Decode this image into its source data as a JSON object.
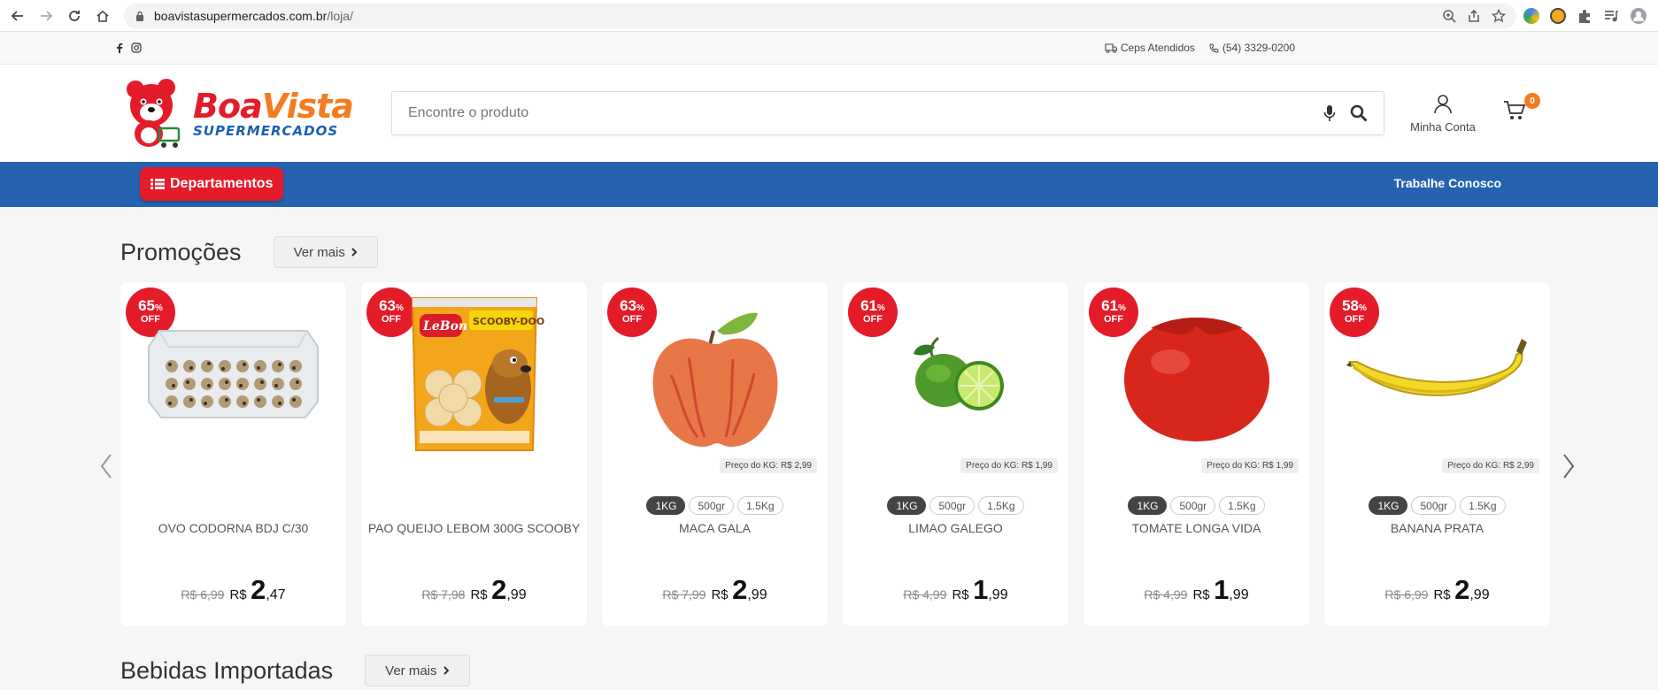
{
  "browser": {
    "url_host": "boavistasupermercados.com.br",
    "url_path": "/loja/"
  },
  "topstrip": {
    "ceps": "Ceps Atendidos",
    "phone": "(54) 3329-0200"
  },
  "header": {
    "logo_boa": "Boa",
    "logo_vista": "Vista",
    "logo_sub": "SUPERMERCADOS",
    "search_placeholder": "Encontre o produto",
    "account_label": "Minha Conta",
    "cart_count": "0"
  },
  "nav": {
    "departments": "Departamentos",
    "work_with_us": "Trabalhe Conosco"
  },
  "sections": {
    "promo_title": "Promoções",
    "bebidas_title": "Bebidas Importadas",
    "ver_mais": "Ver mais"
  },
  "products": [
    {
      "name": "OVO CODORNA BDJ C/30",
      "discount": "65",
      "off": "OFF",
      "old_price": "R$ 6,99",
      "currency": "R$",
      "price_int": "2",
      "price_dec": ",47",
      "kg_price": "",
      "image": "quail-eggs-tray"
    },
    {
      "name": "PAO QUEIJO LEBOM 300G SCOOBY",
      "discount": "63",
      "off": "OFF",
      "old_price": "R$ 7,98",
      "currency": "R$",
      "price_int": "2",
      "price_dec": ",99",
      "kg_price": "",
      "image": "cheese-bread-bag"
    },
    {
      "name": "MACA GALA",
      "discount": "63",
      "off": "OFF",
      "old_price": "R$ 7,99",
      "currency": "R$",
      "price_int": "2",
      "price_dec": ",99",
      "kg_price": "Preço do KG: R$ 2,99",
      "sizes": [
        "1KG",
        "500gr",
        "1.5Kg"
      ],
      "image": "apple"
    },
    {
      "name": "LIMAO GALEGO",
      "discount": "61",
      "off": "OFF",
      "old_price": "R$ 4,99",
      "currency": "R$",
      "price_int": "1",
      "price_dec": ",99",
      "kg_price": "Preço do KG: R$ 1,99",
      "sizes": [
        "1KG",
        "500gr",
        "1.5Kg"
      ],
      "image": "lime"
    },
    {
      "name": "TOMATE LONGA VIDA",
      "discount": "61",
      "off": "OFF",
      "old_price": "R$ 4,99",
      "currency": "R$",
      "price_int": "1",
      "price_dec": ",99",
      "kg_price": "Preço do KG: R$ 1,99",
      "sizes": [
        "1KG",
        "500gr",
        "1.5Kg"
      ],
      "image": "tomato"
    },
    {
      "name": "BANANA PRATA",
      "discount": "58",
      "off": "OFF",
      "old_price": "R$ 6,99",
      "currency": "R$",
      "price_int": "2",
      "price_dec": ",99",
      "kg_price": "Preço do KG: R$ 2,99",
      "sizes": [
        "1KG",
        "500gr",
        "1.5Kg"
      ],
      "image": "banana"
    }
  ],
  "colors": {
    "brand_red": "#e41c2a",
    "brand_blue": "#2563b0",
    "brand_orange": "#f47b20"
  }
}
